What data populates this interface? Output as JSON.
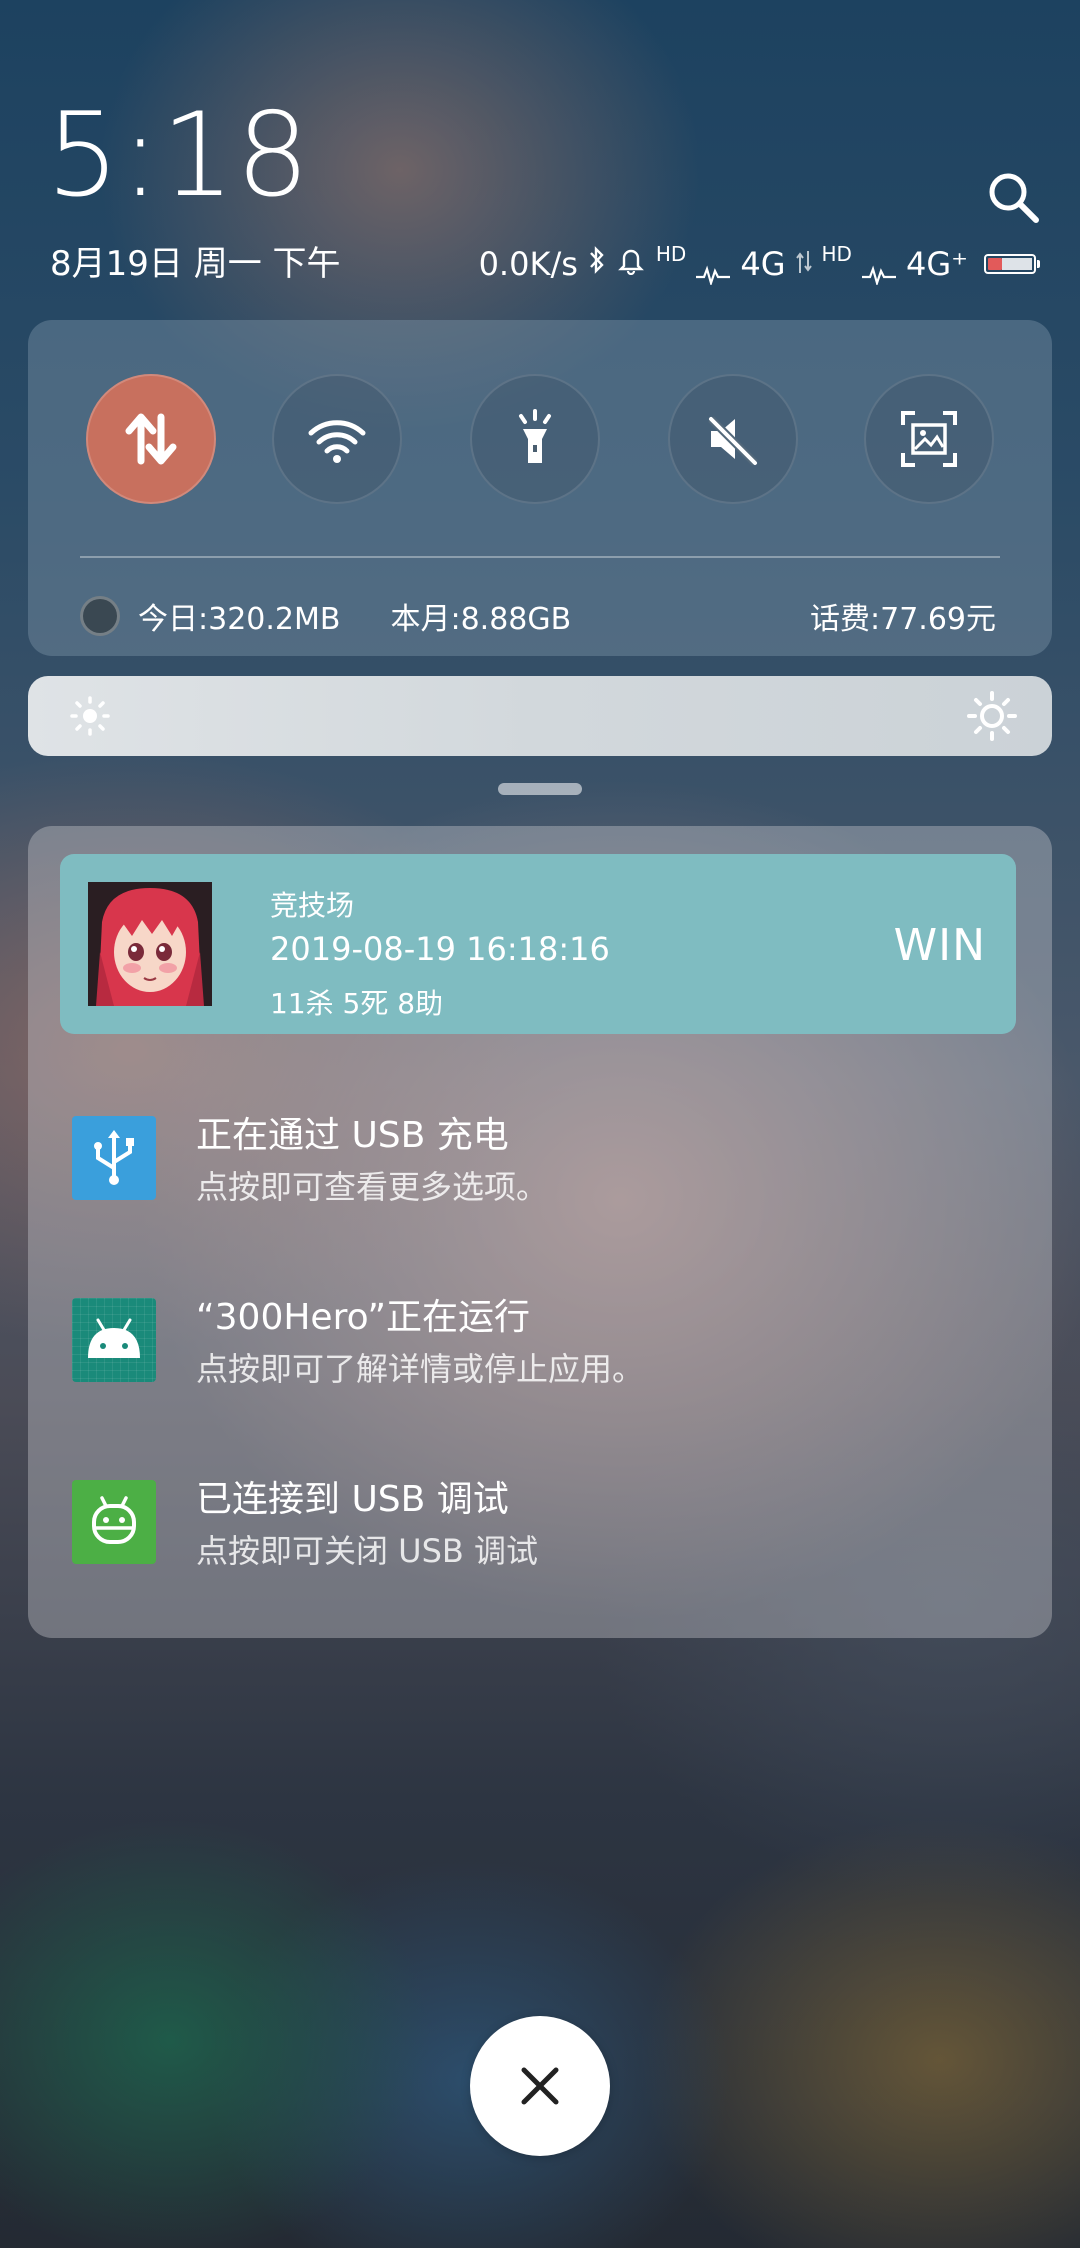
{
  "header": {
    "time": "5:18",
    "date": "8月19日 周一 下午"
  },
  "status_bar": {
    "network_speed": "0.0K/s",
    "sim1_hd": "HD",
    "sim1_type": "4G",
    "sim2_hd": "HD",
    "sim2_type": "4G⁺",
    "battery_level": 0.25
  },
  "quick_settings": {
    "tiles": [
      {
        "name": "mobile-data",
        "icon": "data-transfer-icon",
        "active": true
      },
      {
        "name": "wifi",
        "icon": "wifi-icon",
        "active": false
      },
      {
        "name": "flashlight",
        "icon": "flashlight-icon",
        "active": false
      },
      {
        "name": "mute",
        "icon": "mute-icon",
        "active": false
      },
      {
        "name": "screenshot",
        "icon": "screenshot-icon",
        "active": false
      }
    ],
    "data_today": "今日:320.2MB",
    "data_month": "本月:8.88GB",
    "phone_balance": "话费:77.69元"
  },
  "brightness": {
    "level": 0
  },
  "notifications": {
    "game": {
      "title": "竞技场",
      "time": "2019-08-19 16:18:16",
      "stats": "11杀 5死 8助",
      "result": "WIN"
    },
    "items": [
      {
        "icon": "usb-icon",
        "color": "#3a9fdc",
        "title": "正在通过 USB 充电",
        "subtitle": "点按即可查看更多选项。"
      },
      {
        "icon": "android-icon",
        "color": "#1a8a7a",
        "title": "“300Hero”正在运行",
        "subtitle": "点按即可了解详情或停止应用。"
      },
      {
        "icon": "android-debug-icon",
        "color": "#4caf45",
        "title": "已连接到 USB 调试",
        "subtitle": "点按即可关闭 USB 调试"
      }
    ]
  },
  "colors": {
    "active_tile": "#c8705e",
    "game_card": "#7fbcc1"
  }
}
